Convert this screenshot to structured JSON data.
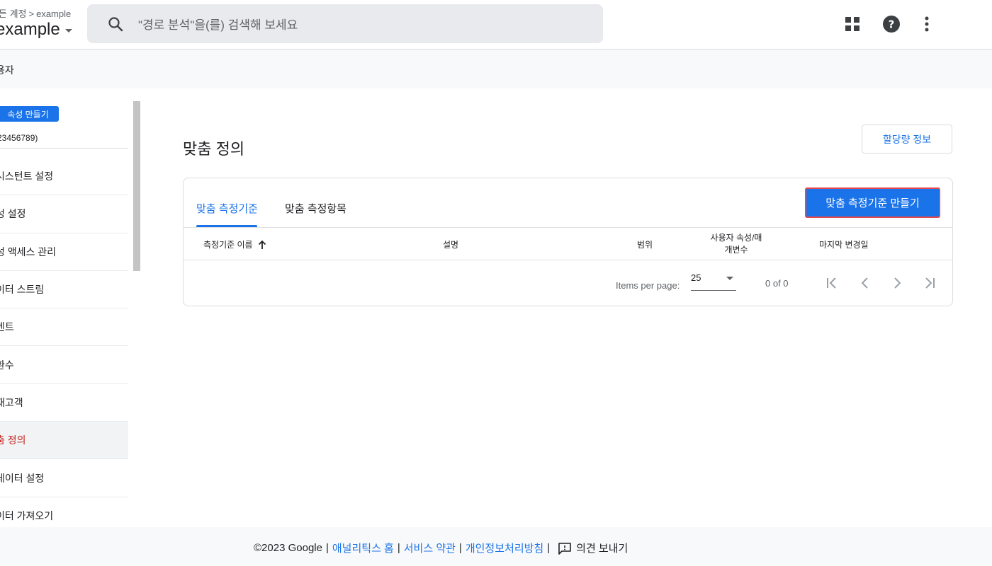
{
  "header": {
    "breadcrumb_prefix": "든 계정",
    "breadcrumb_account": "example",
    "account_name": "example",
    "search_placeholder": "\"경로 분석\"을(를) 검색해 보세요"
  },
  "subbar": {
    "label": "용자"
  },
  "sidebar": {
    "create_button": "속성 만들기",
    "property_id": "23456789)",
    "items": [
      {
        "label": "시스턴트 설정"
      },
      {
        "label": "성 설정"
      },
      {
        "label": "성 액세스 관리"
      },
      {
        "label": "이터 스트림"
      },
      {
        "label": "벤트"
      },
      {
        "label": "환수"
      },
      {
        "label": "재고객"
      },
      {
        "label": "춤 정의",
        "active": true
      },
      {
        "label": "데이터 설정"
      },
      {
        "label": "이터 가져오기"
      }
    ]
  },
  "main": {
    "title": "맞춤 정의",
    "quota_button": "할당량 정보",
    "tabs": [
      {
        "label": "맞춤 측정기준",
        "active": true
      },
      {
        "label": "맞춤 측정항목"
      }
    ],
    "create_dimension_button": "맞춤 측정기준 만들기",
    "table": {
      "headers": {
        "name": "측정기준 이름",
        "description": "설명",
        "scope": "범위",
        "user_property_line1": "사용자 속성/매",
        "user_property_line2": "개변수",
        "last_modified": "마지막 변경일"
      }
    },
    "pager": {
      "items_per_page_label": "Items per page:",
      "items_per_page_value": "25",
      "range": "0 of 0"
    }
  },
  "footer": {
    "copyright": "©2023 Google",
    "analytics_home": "애널리틱스 홈",
    "terms": "서비스 약관",
    "privacy": "개인정보처리방침",
    "feedback": "의견 보내기"
  },
  "colors": {
    "accent": "#1a73e8",
    "active_item": "#c5221f",
    "highlight_border": "#e5484d"
  }
}
